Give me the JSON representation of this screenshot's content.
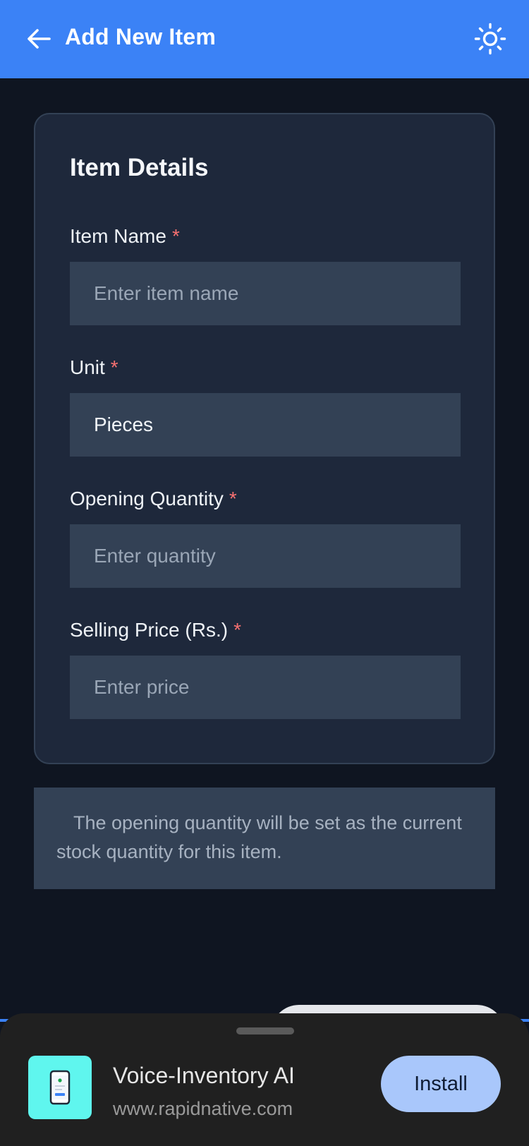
{
  "header": {
    "title": "Add New Item",
    "back_icon": "arrow-left-icon",
    "theme_icon": "sun-icon",
    "color": "#3b82f6"
  },
  "card": {
    "title": "Item Details",
    "fields": [
      {
        "label": "Item Name",
        "required_mark": "*",
        "value": "",
        "placeholder": "Enter item name"
      },
      {
        "label": "Unit",
        "required_mark": "*",
        "value": "Pieces",
        "placeholder": ""
      },
      {
        "label": "Opening Quantity",
        "required_mark": "*",
        "value": "",
        "placeholder": "Enter quantity"
      },
      {
        "label": "Selling Price (Rs.)",
        "required_mark": "*",
        "value": "",
        "placeholder": "Enter price"
      }
    ]
  },
  "note": {
    "text": "The opening quantity will be set as the current stock quantity for this item."
  },
  "install_banner": {
    "app_name": "Voice-Inventory AI",
    "url": "www.rapidnative.com",
    "install_label": "Install",
    "icon": "phone-app-icon"
  }
}
